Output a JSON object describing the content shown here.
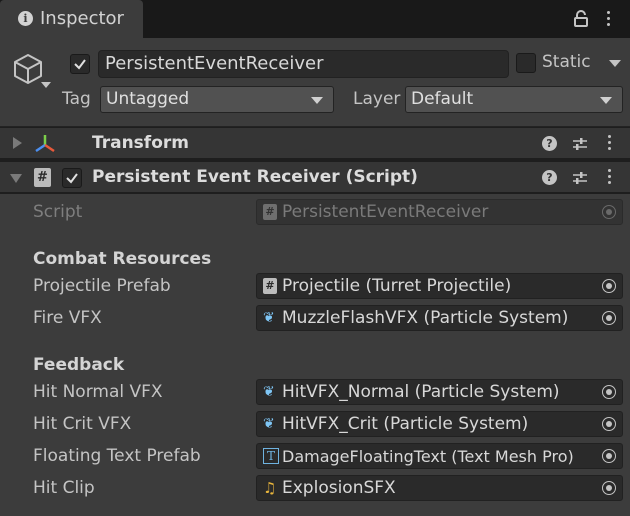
{
  "tab": {
    "title": "Inspector"
  },
  "object": {
    "name": "PersistentEventReceiver",
    "static_label": "Static",
    "tag_label": "Tag",
    "tag_value": "Untagged",
    "layer_label": "Layer",
    "layer_value": "Default"
  },
  "components": {
    "transform": {
      "title": "Transform"
    },
    "script": {
      "title": "Persistent Event Receiver (Script)"
    }
  },
  "fields": {
    "script": {
      "label": "Script",
      "value": "PersistentEventReceiver"
    },
    "combat_section": "Combat Resources",
    "projectile_prefab": {
      "label": "Projectile Prefab",
      "value": "Projectile (Turret Projectile)"
    },
    "fire_vfx": {
      "label": "Fire VFX",
      "value": "MuzzleFlashVFX (Particle System)"
    },
    "feedback_section": "Feedback",
    "hit_normal_vfx": {
      "label": "Hit Normal VFX",
      "value": "HitVFX_Normal (Particle System)"
    },
    "hit_crit_vfx": {
      "label": "Hit Crit VFX",
      "value": "HitVFX_Crit (Particle System)"
    },
    "floating_text_prefab": {
      "label": "Floating Text Prefab",
      "value": "DamageFloatingText (Text Mesh Pro)"
    },
    "hit_clip": {
      "label": "Hit Clip",
      "value": "ExplosionSFX"
    }
  },
  "icons": {
    "tab_icon": "info-icon",
    "gameobject_icon": "cube-icon",
    "transform_icon": "transform-axes-icon",
    "script_icon": "hash-script-icon",
    "particle_icon": "particle-system-icon",
    "text_icon": "text-mesh-pro-icon",
    "audio_icon": "audio-clip-icon"
  },
  "colors": {
    "background": "#3c3c3c",
    "component_header": "#353535",
    "field": "#2a2a2a",
    "text": "#c4c4c4"
  },
  "state": {
    "active": true,
    "static": false,
    "component_enabled": true,
    "transform_expanded": false,
    "script_expanded": true
  }
}
